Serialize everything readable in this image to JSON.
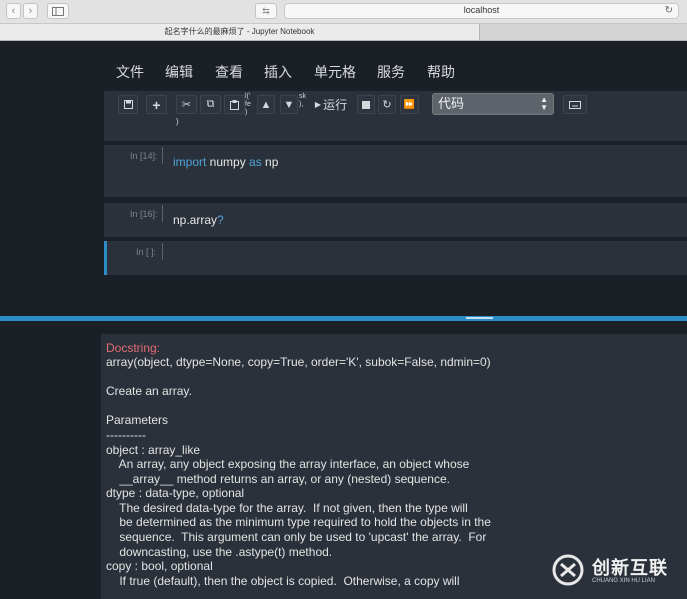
{
  "browser": {
    "url": "localhost",
    "tab_title": "起名字什么的最麻烦了 - Jupyter Notebook"
  },
  "menu": [
    "文件",
    "编辑",
    "查看",
    "插入",
    "单元格",
    "服务",
    "帮助"
  ],
  "toolbar": {
    "run_label": "运行",
    "cell_type": "代码",
    "run_above_label": "l(' fe )",
    "run_below_label": "sk ),"
  },
  "cells": [
    {
      "prompt": "In [14]:",
      "tokens": [
        {
          "t": "import",
          "kw": true
        },
        {
          "t": " numpy ",
          "kw": false
        },
        {
          "t": "as",
          "kw": true
        },
        {
          "t": " np",
          "kw": false
        }
      ]
    },
    {
      "prompt": "In [16]:",
      "tokens": [
        {
          "t": "np.array",
          "kw": false
        },
        {
          "t": "?",
          "kw": true
        }
      ]
    },
    {
      "prompt": "In [ ]:",
      "tokens": []
    }
  ],
  "pager": {
    "heading": "Docstring:",
    "lines": [
      "array(object, dtype=None, copy=True, order='K', subok=False, ndmin=0)",
      "",
      "Create an array.",
      "",
      "Parameters",
      "----------",
      "object : array_like",
      "    An array, any object exposing the array interface, an object whose",
      "    __array__ method returns an array, or any (nested) sequence.",
      "dtype : data-type, optional",
      "    The desired data-type for the array.  If not given, then the type will",
      "    be determined as the minimum type required to hold the objects in the",
      "    sequence.  This argument can only be used to 'upcast' the array.  For",
      "    downcasting, use the .astype(t) method.",
      "copy : bool, optional",
      "    If true (default), then the object is copied.  Otherwise, a copy will"
    ]
  },
  "watermark": {
    "brand": "创新互联",
    "pinyin": "CHUANG XIN HU LIAN"
  },
  "colors": {
    "accent": "#2d8bc7",
    "keyword": "#4fa3d8",
    "docstring_heading": "#e06c75"
  }
}
